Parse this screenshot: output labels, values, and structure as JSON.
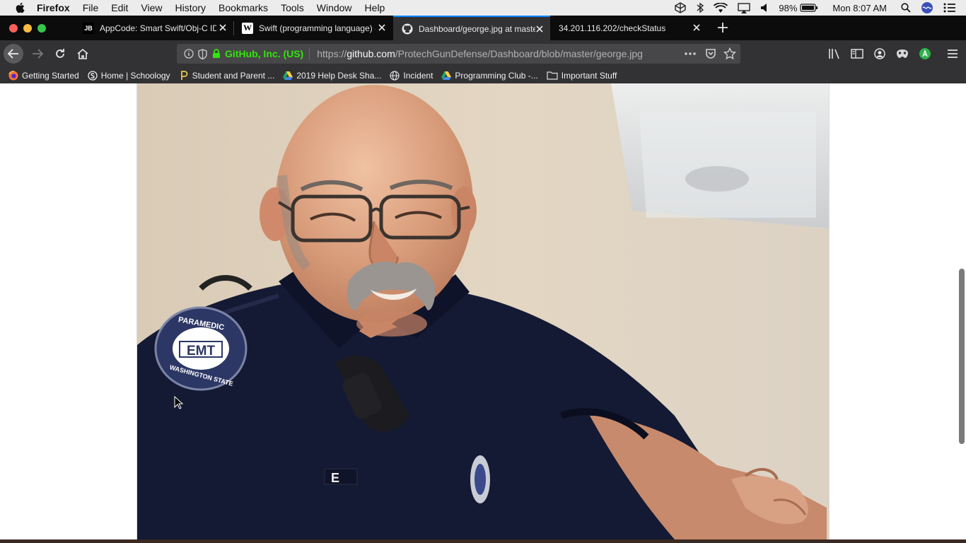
{
  "menubar": {
    "app_name": "Firefox",
    "items": [
      "File",
      "Edit",
      "View",
      "History",
      "Bookmarks",
      "Tools",
      "Window",
      "Help"
    ],
    "battery": "98%",
    "clock": "Mon 8:07 AM"
  },
  "tabs": [
    {
      "favicon": "JB",
      "title": "AppCode: Smart Swift/Obj-C ID",
      "active": false
    },
    {
      "favicon": "W",
      "title": "Swift (programming language) -",
      "active": false
    },
    {
      "favicon": "github-icon",
      "title": "Dashboard/george.jpg at maste",
      "active": true
    },
    {
      "favicon": "",
      "title": "34.201.116.202/checkStatus",
      "active": false
    }
  ],
  "urlbar": {
    "identity": "GitHub, Inc. (US)",
    "url_prefix": "https://",
    "url_host": "github.com",
    "url_path": "/ProtechGunDefense/Dashboard/blob/master/george.jpg"
  },
  "bookmarks": [
    {
      "label": "Getting Started",
      "icon": "firefox-icon"
    },
    {
      "label": "Home | Schoology",
      "icon": "schoology-icon"
    },
    {
      "label": "Student and Parent ...",
      "icon": "portal-icon"
    },
    {
      "label": "2019 Help Desk Sha...",
      "icon": "drive-icon"
    },
    {
      "label": "Incident",
      "icon": "globe-icon"
    },
    {
      "label": "Programming Club -...",
      "icon": "drive-icon"
    },
    {
      "label": "Important Stuff",
      "icon": "folder-icon"
    }
  ],
  "photo": {
    "patch_top": "PARAMEDIC",
    "patch_center": "EMT",
    "patch_bottom": "WASHINGTON STATE",
    "name_tag": "E"
  },
  "colors": {
    "accent": "#0a84ff",
    "secure": "#30e60b",
    "uniform": "#141a33"
  }
}
